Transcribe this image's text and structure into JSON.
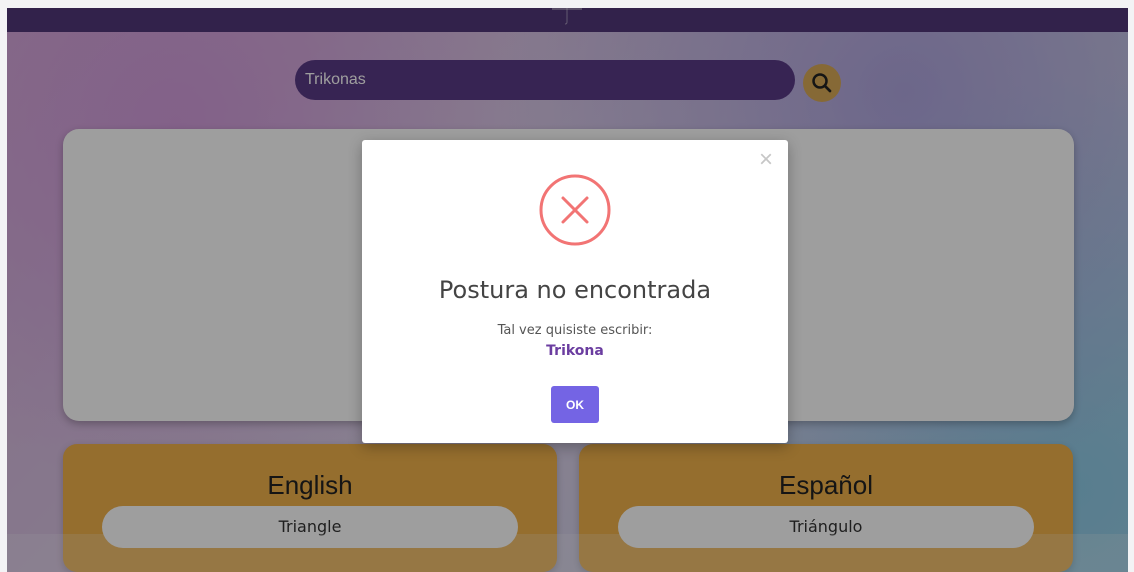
{
  "colors": {
    "topbar": "#52387a",
    "search": "#5a3a86",
    "search_button": "#d9aa57",
    "language_card": "#f0b24b",
    "error_icon": "#f27474",
    "ok_button": "#7464e4",
    "suggestion": "#6b3da0"
  },
  "search": {
    "value": "Trikonas",
    "icon": "search-icon"
  },
  "modal": {
    "close_icon": "close-icon",
    "status_icon": "error-circle-icon",
    "title": "Postura no encontrada",
    "message": "Tal vez quisiste escribir:",
    "suggestion": "Trikona",
    "ok_label": "OK"
  },
  "translations": {
    "english": {
      "title": "English",
      "value": "Triangle"
    },
    "spanish": {
      "title": "Español",
      "value": "Triángulo"
    }
  }
}
